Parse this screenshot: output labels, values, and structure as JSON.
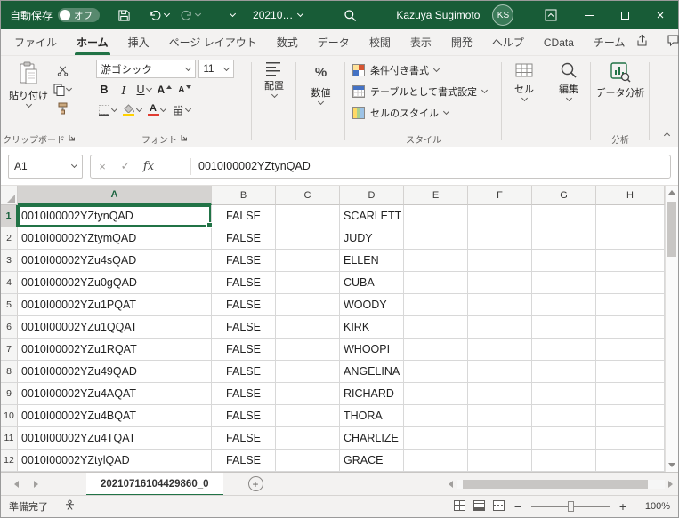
{
  "theme": {
    "title_green": "#185C37",
    "accent_green": "#217346"
  },
  "titlebar": {
    "autosave_label": "自動保存",
    "autosave_state": "オフ",
    "filename": "20210…",
    "user_name": "Kazuya Sugimoto",
    "user_initials": "KS"
  },
  "ribbon_tabs": {
    "items": [
      {
        "label": "ファイル",
        "active": false
      },
      {
        "label": "ホーム",
        "active": true
      },
      {
        "label": "挿入",
        "active": false
      },
      {
        "label": "ページ レイアウト",
        "active": false
      },
      {
        "label": "数式",
        "active": false
      },
      {
        "label": "データ",
        "active": false
      },
      {
        "label": "校閲",
        "active": false
      },
      {
        "label": "表示",
        "active": false
      },
      {
        "label": "開発",
        "active": false
      },
      {
        "label": "ヘルプ",
        "active": false
      },
      {
        "label": "CData",
        "active": false
      },
      {
        "label": "チーム",
        "active": false
      }
    ]
  },
  "ribbon": {
    "paste_label": "貼り付け",
    "clipboard_group_label": "クリップボード",
    "font_name": "游ゴシック",
    "font_size": "11",
    "font_group_label": "フォント",
    "align_label": "配置",
    "number_label": "数値",
    "style_buttons": [
      "条件付き書式",
      "テーブルとして書式設定",
      "セルのスタイル"
    ],
    "style_group_label": "スタイル",
    "cells_label": "セル",
    "editing_label": "編集",
    "analysis_label": "データ分析",
    "analysis_group_label": "分析",
    "glyphs": {
      "bold": "B",
      "italic": "I",
      "underline": "U",
      "font_a": "A",
      "percent": "%"
    }
  },
  "formula_bar": {
    "name_box_value": "A1",
    "fx_label": "fx",
    "value": "0010I00002YZtynQAD"
  },
  "grid": {
    "column_headers": [
      "A",
      "B",
      "C",
      "D",
      "E",
      "F",
      "G",
      "H"
    ],
    "selected_cell": "A1",
    "rows": [
      {
        "num": "1",
        "cells": [
          "0010I00002YZtynQAD",
          "FALSE",
          "",
          "SCARLETT",
          "",
          "",
          "",
          ""
        ]
      },
      {
        "num": "2",
        "cells": [
          "0010I00002YZtymQAD",
          "FALSE",
          "",
          "JUDY",
          "",
          "",
          "",
          ""
        ]
      },
      {
        "num": "3",
        "cells": [
          "0010I00002YZu4sQAD",
          "FALSE",
          "",
          "ELLEN",
          "",
          "",
          "",
          ""
        ]
      },
      {
        "num": "4",
        "cells": [
          "0010I00002YZu0gQAD",
          "FALSE",
          "",
          "CUBA",
          "",
          "",
          "",
          ""
        ]
      },
      {
        "num": "5",
        "cells": [
          "0010I00002YZu1PQAT",
          "FALSE",
          "",
          "WOODY",
          "",
          "",
          "",
          ""
        ]
      },
      {
        "num": "6",
        "cells": [
          "0010I00002YZu1QQAT",
          "FALSE",
          "",
          "KIRK",
          "",
          "",
          "",
          ""
        ]
      },
      {
        "num": "7",
        "cells": [
          "0010I00002YZu1RQAT",
          "FALSE",
          "",
          "WHOOPI",
          "",
          "",
          "",
          ""
        ]
      },
      {
        "num": "8",
        "cells": [
          "0010I00002YZu49QAD",
          "FALSE",
          "",
          "ANGELINA",
          "",
          "",
          "",
          ""
        ]
      },
      {
        "num": "9",
        "cells": [
          "0010I00002YZu4AQAT",
          "FALSE",
          "",
          "RICHARD",
          "",
          "",
          "",
          ""
        ]
      },
      {
        "num": "10",
        "cells": [
          "0010I00002YZu4BQAT",
          "FALSE",
          "",
          "THORA",
          "",
          "",
          "",
          ""
        ]
      },
      {
        "num": "11",
        "cells": [
          "0010I00002YZu4TQAT",
          "FALSE",
          "",
          "CHARLIZE",
          "",
          "",
          "",
          ""
        ]
      },
      {
        "num": "12",
        "cells": [
          "0010I00002YZtylQAD",
          "FALSE",
          "",
          "GRACE",
          "",
          "",
          "",
          ""
        ]
      }
    ]
  },
  "sheet_bar": {
    "active_tab": "20210716104429860_0"
  },
  "status_bar": {
    "ready_label": "準備完了",
    "zoom_level": "100%"
  }
}
